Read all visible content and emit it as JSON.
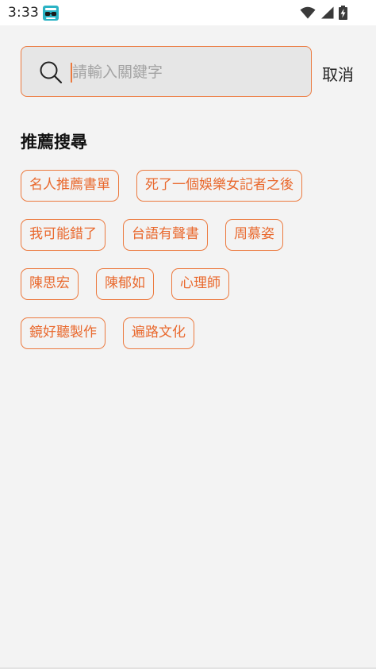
{
  "status_bar": {
    "time": "3:33",
    "app_icon": "hami-app-icon",
    "icons": [
      "wifi-icon",
      "signal-icon",
      "battery-charging-icon"
    ]
  },
  "search": {
    "placeholder": "請輸入關鍵字",
    "value": "",
    "cancel_label": "取消"
  },
  "recommend": {
    "title": "推薦搜尋",
    "rows": [
      [
        "名人推薦書單",
        "死了一個娛樂女記者之後"
      ],
      [
        "我可能錯了",
        "台語有聲書",
        "周慕姿"
      ],
      [
        "陳思宏",
        "陳郁如",
        "心理師"
      ],
      [
        "鏡好聽製作",
        "遍路文化"
      ]
    ]
  },
  "colors": {
    "accent": "#ec7a3f",
    "tag_text": "#e9692e",
    "background": "#f3f3f3",
    "search_bg": "#e6e6e6"
  }
}
